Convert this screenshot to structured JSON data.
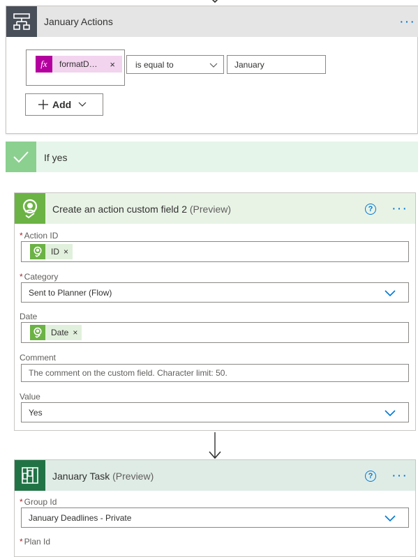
{
  "condition": {
    "title": "January Actions",
    "more": "···",
    "token_label": "formatD…",
    "token_close": "×",
    "operator": "is equal to",
    "value": "January",
    "add_label": "Add"
  },
  "if_yes": {
    "title": "If yes"
  },
  "action": {
    "title": "Create an action custom field 2",
    "preview": "(Preview)",
    "help": "?",
    "more": "···",
    "action_id": {
      "label": "Action ID",
      "token": "ID",
      "token_close": "×"
    },
    "category": {
      "label": "Category",
      "value": "Sent to Planner (Flow)"
    },
    "date": {
      "label": "Date",
      "token": "Date",
      "token_close": "×"
    },
    "comment": {
      "label": "Comment",
      "placeholder": "The comment on the custom field. Character limit: 50."
    },
    "value": {
      "label": "Value",
      "value": "Yes"
    }
  },
  "task": {
    "title": "January Task",
    "preview": "(Preview)",
    "help": "?",
    "more": "···",
    "group_id": {
      "label": "Group Id",
      "value": "January Deadlines - Private"
    },
    "plan_id": {
      "label": "Plan Id"
    }
  },
  "required_mark": "*",
  "colors": {
    "condition_icon_bg": "#484f58",
    "condition_header_bg": "#e5e5e5",
    "ifyes_bg": "#e6f5e9",
    "ifyes_icon_bg": "#8bd08f",
    "action_header_bg": "#e8f3e6",
    "action_icon_bg": "#6bb344",
    "task_header_bg": "#dfece6",
    "task_icon_bg": "#217346",
    "accent": "#0078d4",
    "fx_token_bg": "#f2d4ef",
    "fx_badge_bg": "#b4009e"
  },
  "icons": [
    "condition-icon",
    "fx-icon",
    "close-icon",
    "chevron-down-icon",
    "plus-icon",
    "checkmark-icon",
    "custom-field-icon",
    "help-icon",
    "more-icon",
    "planner-icon",
    "arrow-down-icon"
  ]
}
